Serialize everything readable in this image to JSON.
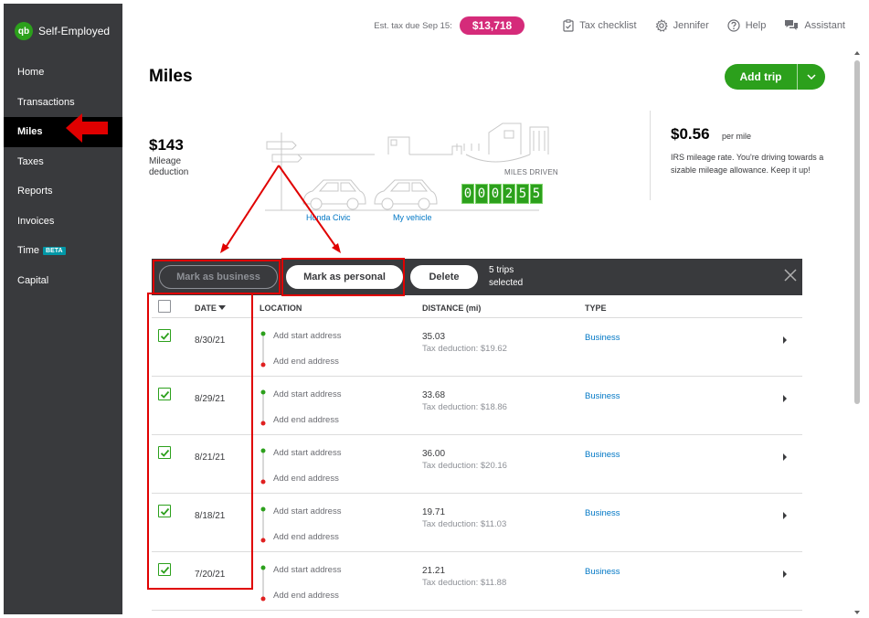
{
  "app": {
    "brand": "Self-Employed",
    "logo_text": "qb"
  },
  "sidebar": {
    "items": [
      {
        "label": "Home"
      },
      {
        "label": "Transactions"
      },
      {
        "label": "Miles",
        "active": true
      },
      {
        "label": "Taxes"
      },
      {
        "label": "Reports"
      },
      {
        "label": "Invoices"
      },
      {
        "label": "Time",
        "badge": "BETA"
      },
      {
        "label": "Capital"
      }
    ]
  },
  "topbar": {
    "est_tax_label": "Est. tax due Sep 15:",
    "est_tax_amount": "$13,718",
    "tax_checklist": "Tax checklist",
    "user": "Jennifer",
    "help": "Help",
    "assistant": "Assistant"
  },
  "page": {
    "title": "Miles",
    "add_trip": "Add trip"
  },
  "summary": {
    "deduction_amount": "$143",
    "deduction_label": "Mileage deduction",
    "miles_driven_label": "MILES DRIVEN",
    "odometer_digits": [
      "0",
      "0",
      "0",
      "2",
      "5",
      "5"
    ],
    "vehicles": [
      "Honda Civic",
      "My vehicle"
    ],
    "rate": "$0.56",
    "rate_unit": "per mile",
    "rate_description": "IRS mileage rate. You're driving towards a sizable mileage allowance. Keep it up!"
  },
  "action_bar": {
    "mark_business": "Mark as business",
    "mark_personal": "Mark as personal",
    "delete": "Delete",
    "selected_count": "5 trips selected"
  },
  "table": {
    "headers": {
      "date": "DATE",
      "location": "LOCATION",
      "distance": "DISTANCE (mi)",
      "type": "TYPE"
    },
    "rows": [
      {
        "date": "8/30/21",
        "start": "Add start address",
        "end": "Add end address",
        "distance": "35.03",
        "deduction": "Tax deduction: $19.62",
        "type": "Business",
        "checked": true
      },
      {
        "date": "8/29/21",
        "start": "Add start address",
        "end": "Add end address",
        "distance": "33.68",
        "deduction": "Tax deduction: $18.86",
        "type": "Business",
        "checked": true
      },
      {
        "date": "8/21/21",
        "start": "Add start address",
        "end": "Add end address",
        "distance": "36.00",
        "deduction": "Tax deduction: $20.16",
        "type": "Business",
        "checked": true
      },
      {
        "date": "8/18/21",
        "start": "Add start address",
        "end": "Add end address",
        "distance": "19.71",
        "deduction": "Tax deduction: $11.03",
        "type": "Business",
        "checked": true
      },
      {
        "date": "7/20/21",
        "start": "Add start address",
        "end": "Add end address",
        "distance": "21.21",
        "deduction": "Tax deduction: $11.88",
        "type": "Business",
        "checked": true
      }
    ]
  },
  "colors": {
    "brand_green": "#2ca01c",
    "tax_pill": "#d52b7a",
    "sidebar_bg": "#393a3d",
    "link_blue": "#0077c5",
    "annotation_red": "#e00000"
  }
}
